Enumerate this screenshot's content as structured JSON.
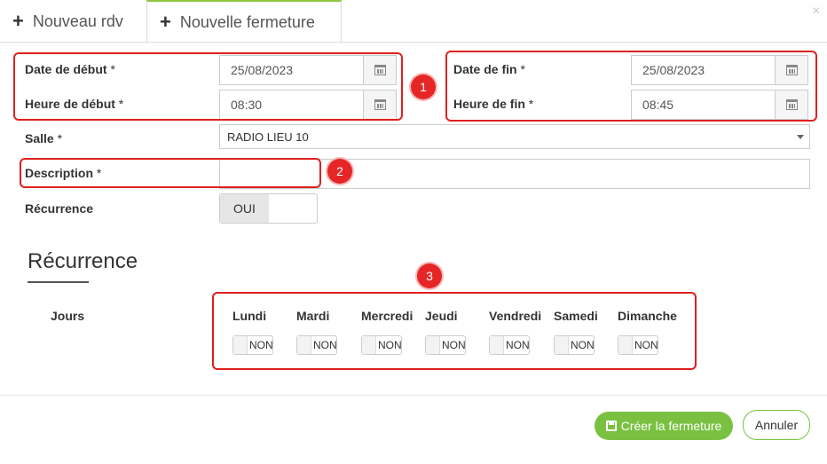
{
  "tabs": [
    {
      "icon": "plus-icon",
      "label": "Nouveau rdv",
      "active": false
    },
    {
      "icon": "plus-icon",
      "label": "Nouvelle fermeture",
      "active": true
    }
  ],
  "close_glyph": "×",
  "form": {
    "date_debut": {
      "label": "Date de début",
      "required": "*",
      "value": "25/08/2023"
    },
    "heure_debut": {
      "label": "Heure de début",
      "required": "*",
      "value": "08:30"
    },
    "date_fin": {
      "label": "Date de fin",
      "required": "*",
      "value": "25/08/2023"
    },
    "heure_fin": {
      "label": "Heure de fin",
      "required": "*",
      "value": "08:45"
    },
    "salle": {
      "label": "Salle",
      "required": "*",
      "value": "RADIO LIEU 10"
    },
    "description": {
      "label": "Description",
      "required": "*",
      "value": ""
    },
    "recurrence": {
      "label": "Récurrence",
      "toggle_label": "OUI"
    }
  },
  "recurrence_section": {
    "title": "Récurrence",
    "jours_label": "Jours",
    "days": [
      {
        "label": "Lundi",
        "toggle": "NON"
      },
      {
        "label": "Mardi",
        "toggle": "NON"
      },
      {
        "label": "Mercredi",
        "toggle": "NON"
      },
      {
        "label": "Jeudi",
        "toggle": "NON"
      },
      {
        "label": "Vendredi",
        "toggle": "NON"
      },
      {
        "label": "Samedi",
        "toggle": "NON"
      },
      {
        "label": "Dimanche",
        "toggle": "NON"
      }
    ]
  },
  "annotations": [
    "1",
    "2",
    "3"
  ],
  "buttons": {
    "create": {
      "label": "Créer la fermeture",
      "icon": "save-icon"
    },
    "cancel": {
      "label": "Annuler"
    }
  },
  "colors": {
    "accent_green": "#7ac142",
    "annotation_red": "#e02020"
  }
}
